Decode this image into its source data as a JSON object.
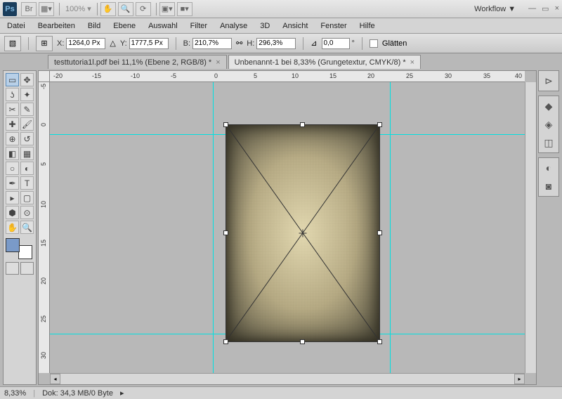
{
  "titlebar": {
    "app": "Ps",
    "zoom": "100% ▾",
    "workflow": "Workflow ▼"
  },
  "menu": [
    "Datei",
    "Bearbeiten",
    "Bild",
    "Ebene",
    "Auswahl",
    "Filter",
    "Analyse",
    "3D",
    "Ansicht",
    "Fenster",
    "Hilfe"
  ],
  "options": {
    "x_label": "X:",
    "x": "1264,0 Px",
    "y_label": "Y:",
    "y": "1777,5 Px",
    "w_label": "B:",
    "w": "210,7%",
    "h_label": "H:",
    "h": "296,3%",
    "angle_label": "",
    "angle": "0,0",
    "angle_unit": "°",
    "smooth": "Glätten"
  },
  "tabs": [
    {
      "label": "testtutoria1l.pdf bei 11,1% (Ebene 2, RGB/8) *"
    },
    {
      "label": "Unbenannt-1 bei 8,33% (Grungetextur, CMYK/8) *"
    }
  ],
  "ruler_h": [
    "-20",
    "-15",
    "-10",
    "-5",
    "0",
    "5",
    "10",
    "15",
    "20",
    "25",
    "30",
    "35",
    "40"
  ],
  "ruler_v": [
    "-5",
    "0",
    "5",
    "10",
    "15",
    "20",
    "25",
    "30"
  ],
  "status": {
    "zoom": "8,33%",
    "doc": "Dok: 34,3 MB/0 Byte"
  }
}
